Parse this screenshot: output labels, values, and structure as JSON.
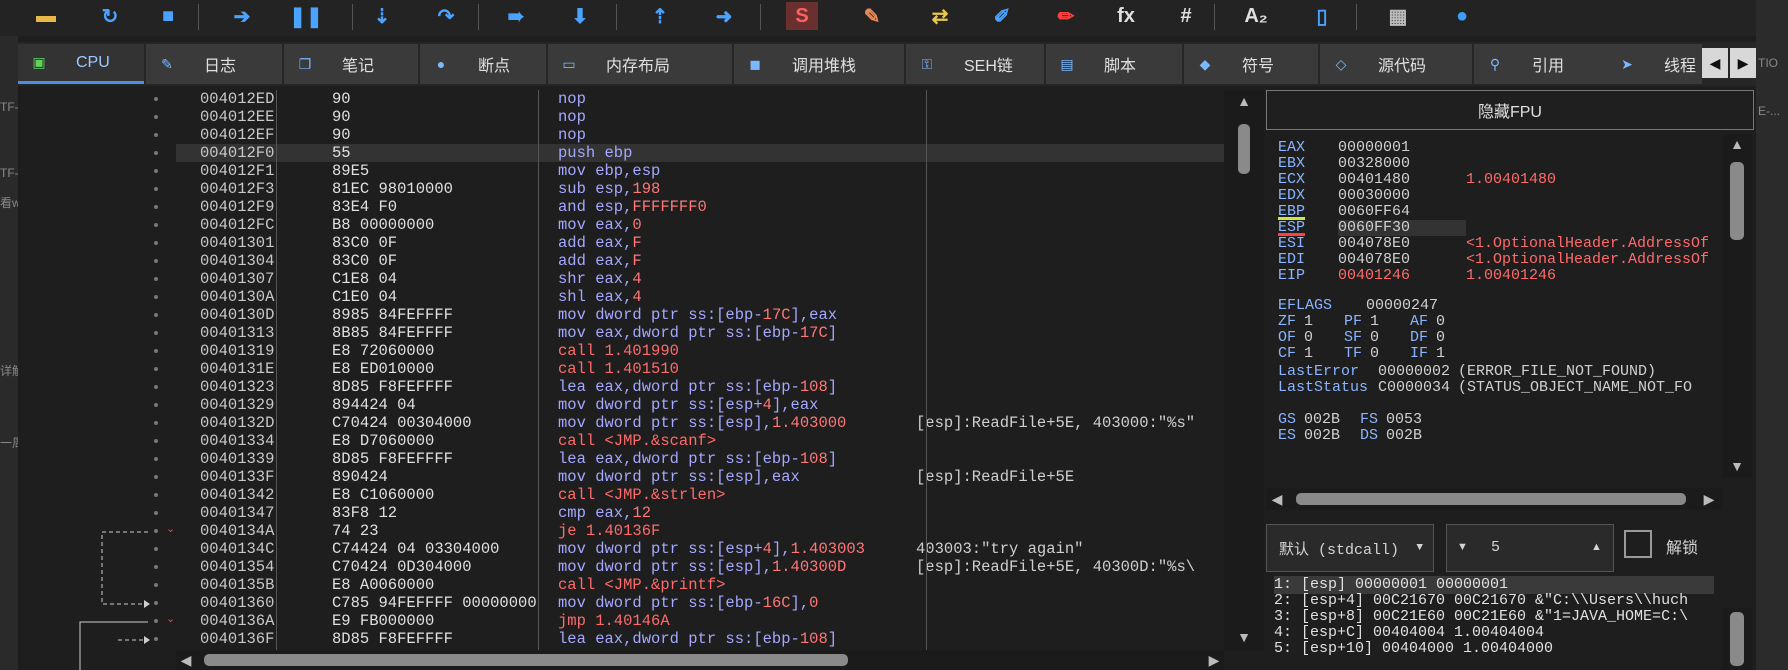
{
  "toolbar": {
    "buttons": [
      {
        "icon": "open-folder-icon",
        "glyph": "▬",
        "color": "#e8b84a"
      },
      {
        "icon": "restart-icon",
        "glyph": "↻",
        "color": "#4aa3ff"
      },
      {
        "icon": "close-icon",
        "glyph": "■",
        "color": "#4aa3ff"
      },
      {
        "icon": "run-icon",
        "glyph": "➔",
        "color": "#4aa3ff"
      },
      {
        "icon": "pause-icon",
        "glyph": "❚❚",
        "color": "#4aa3ff"
      },
      {
        "icon": "step-into-icon",
        "glyph": "⇣",
        "color": "#4aa3ff"
      },
      {
        "icon": "step-over-icon",
        "glyph": "↷",
        "color": "#4aa3ff"
      },
      {
        "icon": "trace-into-icon",
        "glyph": "➠",
        "color": "#4aa3ff"
      },
      {
        "icon": "trace-over-icon",
        "glyph": "⬇",
        "color": "#4aa3ff"
      },
      {
        "icon": "execute-till-return-icon",
        "glyph": "⇡",
        "color": "#4aa3ff"
      },
      {
        "icon": "run-to-user-code-icon",
        "glyph": "➜",
        "color": "#4aa3ff"
      },
      {
        "icon": "script-icon",
        "glyph": "S",
        "color": "#ff4040"
      },
      {
        "icon": "patch-icon",
        "glyph": "✎",
        "color": "#e88a5a"
      },
      {
        "icon": "memory-map-icon",
        "glyph": "⇄",
        "color": "#e8c84a"
      },
      {
        "icon": "breakpoints-icon",
        "glyph": "✐",
        "color": "#4aa3ff"
      },
      {
        "icon": "highlight-icon",
        "glyph": "✏",
        "color": "#ff4040"
      },
      {
        "icon": "function-icon",
        "glyph": "fx",
        "color": "#e0e0e0"
      },
      {
        "icon": "hash-icon",
        "glyph": "#",
        "color": "#e0e0e0"
      },
      {
        "icon": "font-icon",
        "glyph": "A₂",
        "color": "#e0e0e0"
      },
      {
        "icon": "device-icon",
        "glyph": "▯",
        "color": "#4aa3ff"
      },
      {
        "icon": "calculator-icon",
        "glyph": "▦",
        "color": "#bbbbbb"
      },
      {
        "icon": "globe-icon",
        "glyph": "●",
        "color": "#3aa0ff"
      }
    ]
  },
  "left_cut_text": [
    "TF-",
    "TF-",
    "看w",
    "详解",
    "一周"
  ],
  "right_cut_text": [
    "TIO",
    "E-..."
  ],
  "tabs": [
    {
      "label": "CPU",
      "icon": "cpu-icon",
      "glyph": "▣",
      "active": true
    },
    {
      "label": "日志",
      "icon": "log-icon",
      "glyph": "✎",
      "active": false
    },
    {
      "label": "笔记",
      "icon": "notes-icon",
      "glyph": "❐",
      "active": false
    },
    {
      "label": "断点",
      "icon": "breakpoint-icon",
      "glyph": "●",
      "active": false
    },
    {
      "label": "内存布局",
      "icon": "memory-layout-icon",
      "glyph": "▭",
      "active": false
    },
    {
      "label": "调用堆栈",
      "icon": "call-stack-icon",
      "glyph": "◼",
      "active": false
    },
    {
      "label": "SEH链",
      "icon": "seh-chain-icon",
      "glyph": "⚿",
      "active": false
    },
    {
      "label": "脚本",
      "icon": "script-tab-icon",
      "glyph": "▤",
      "active": false
    },
    {
      "label": "符号",
      "icon": "symbols-icon",
      "glyph": "◆",
      "active": false
    },
    {
      "label": "源代码",
      "icon": "source-code-icon",
      "glyph": "◇",
      "active": false
    },
    {
      "label": "引用",
      "icon": "references-icon",
      "glyph": "⚲",
      "active": false
    },
    {
      "label": "线程",
      "icon": "threads-icon",
      "glyph": "➤",
      "active": false
    }
  ],
  "tab_nav": {
    "prev": "◀",
    "next": "▶"
  },
  "disasm": {
    "rows": [
      {
        "addr": "004012ED",
        "bytes": "90",
        "instr": [
          {
            "t": "nop"
          }
        ],
        "comment": ""
      },
      {
        "addr": "004012EE",
        "bytes": "90",
        "instr": [
          {
            "t": "nop"
          }
        ],
        "comment": ""
      },
      {
        "addr": "004012EF",
        "bytes": "90",
        "instr": [
          {
            "t": "nop"
          }
        ],
        "comment": ""
      },
      {
        "addr": "004012F0",
        "bytes": "55",
        "instr": [
          {
            "t": "push ebp"
          }
        ],
        "comment": "",
        "selected": true
      },
      {
        "addr": "004012F1",
        "bytes": "89E5",
        "instr": [
          {
            "t": "mov ebp,esp"
          }
        ],
        "comment": ""
      },
      {
        "addr": "004012F3",
        "bytes": "81EC 98010000",
        "instr": [
          {
            "t": "sub esp,"
          },
          {
            "t": "198",
            "c": "num"
          }
        ],
        "comment": ""
      },
      {
        "addr": "004012F9",
        "bytes": "83E4 F0",
        "instr": [
          {
            "t": "and esp,"
          },
          {
            "t": "FFFFFFF0",
            "c": "num"
          }
        ],
        "comment": ""
      },
      {
        "addr": "004012FC",
        "bytes": "B8 00000000",
        "instr": [
          {
            "t": "mov eax,"
          },
          {
            "t": "0",
            "c": "num"
          }
        ],
        "comment": ""
      },
      {
        "addr": "00401301",
        "bytes": "83C0 0F",
        "instr": [
          {
            "t": "add eax,"
          },
          {
            "t": "F",
            "c": "num"
          }
        ],
        "comment": ""
      },
      {
        "addr": "00401304",
        "bytes": "83C0 0F",
        "instr": [
          {
            "t": "add eax,"
          },
          {
            "t": "F",
            "c": "num"
          }
        ],
        "comment": ""
      },
      {
        "addr": "00401307",
        "bytes": "C1E8 04",
        "instr": [
          {
            "t": "shr eax,"
          },
          {
            "t": "4",
            "c": "num"
          }
        ],
        "comment": ""
      },
      {
        "addr": "0040130A",
        "bytes": "C1E0 04",
        "instr": [
          {
            "t": "shl eax,"
          },
          {
            "t": "4",
            "c": "num"
          }
        ],
        "comment": ""
      },
      {
        "addr": "0040130D",
        "bytes": "8985 84FEFFFF",
        "instr": [
          {
            "t": "mov dword ptr ss:[ebp-"
          },
          {
            "t": "17C",
            "c": "num"
          },
          {
            "t": "],eax"
          }
        ],
        "comment": ""
      },
      {
        "addr": "00401313",
        "bytes": "8B85 84FEFFFF",
        "instr": [
          {
            "t": "mov eax,dword ptr ss:[ebp-"
          },
          {
            "t": "17C",
            "c": "num"
          },
          {
            "t": "]"
          }
        ],
        "comment": ""
      },
      {
        "addr": "00401319",
        "bytes": "E8 72060000",
        "instr": [
          {
            "t": "call 1.401990",
            "c": "call"
          }
        ],
        "comment": ""
      },
      {
        "addr": "0040131E",
        "bytes": "E8 ED010000",
        "instr": [
          {
            "t": "call 1.401510",
            "c": "call"
          }
        ],
        "comment": ""
      },
      {
        "addr": "00401323",
        "bytes": "8D85 F8FEFFFF",
        "instr": [
          {
            "t": "lea eax,dword ptr ss:[ebp-"
          },
          {
            "t": "108",
            "c": "num"
          },
          {
            "t": "]"
          }
        ],
        "comment": ""
      },
      {
        "addr": "00401329",
        "bytes": "894424 04",
        "instr": [
          {
            "t": "mov dword ptr ss:[esp+"
          },
          {
            "t": "4",
            "c": "num"
          },
          {
            "t": "],eax"
          }
        ],
        "comment": ""
      },
      {
        "addr": "0040132D",
        "bytes": "C70424 00304000",
        "instr": [
          {
            "t": "mov dword ptr ss:[esp],"
          },
          {
            "t": "1.403000",
            "c": "num"
          }
        ],
        "comment": "[esp]:ReadFile+5E, 403000:\"%s\""
      },
      {
        "addr": "00401334",
        "bytes": "E8 D7060000",
        "instr": [
          {
            "t": "call <JMP.&scanf>",
            "c": "call"
          }
        ],
        "comment": ""
      },
      {
        "addr": "00401339",
        "bytes": "8D85 F8FEFFFF",
        "instr": [
          {
            "t": "lea eax,dword ptr ss:[ebp-"
          },
          {
            "t": "108",
            "c": "num"
          },
          {
            "t": "]"
          }
        ],
        "comment": ""
      },
      {
        "addr": "0040133F",
        "bytes": "890424",
        "instr": [
          {
            "t": "mov dword ptr ss:[esp],eax"
          }
        ],
        "comment": "[esp]:ReadFile+5E"
      },
      {
        "addr": "00401342",
        "bytes": "E8 C1060000",
        "instr": [
          {
            "t": "call <JMP.&strlen>",
            "c": "call"
          }
        ],
        "comment": ""
      },
      {
        "addr": "00401347",
        "bytes": "83F8 12",
        "instr": [
          {
            "t": "cmp eax,"
          },
          {
            "t": "12",
            "c": "num"
          }
        ],
        "comment": ""
      },
      {
        "addr": "0040134A",
        "bytes": "74 23",
        "instr": [
          {
            "t": "je 1.40136F",
            "c": "jmp"
          }
        ],
        "comment": "",
        "branch": true
      },
      {
        "addr": "0040134C",
        "bytes": "C74424 04 03304000",
        "instr": [
          {
            "t": "mov dword ptr ss:[esp+"
          },
          {
            "t": "4",
            "c": "num"
          },
          {
            "t": "],"
          },
          {
            "t": "1.403003",
            "c": "num"
          }
        ],
        "comment": "403003:\"try again\""
      },
      {
        "addr": "00401354",
        "bytes": "C70424 0D304000",
        "instr": [
          {
            "t": "mov dword ptr ss:[esp],"
          },
          {
            "t": "1.40300D",
            "c": "num"
          }
        ],
        "comment": "[esp]:ReadFile+5E, 40300D:\"%s\\"
      },
      {
        "addr": "0040135B",
        "bytes": "E8 A0060000",
        "instr": [
          {
            "t": "call <JMP.&printf>",
            "c": "call"
          }
        ],
        "comment": ""
      },
      {
        "addr": "00401360",
        "bytes": "C785 94FEFFFF 00000000",
        "instr": [
          {
            "t": "mov dword ptr ss:[ebp-"
          },
          {
            "t": "16C",
            "c": "num"
          },
          {
            "t": "],"
          },
          {
            "t": "0",
            "c": "num"
          }
        ],
        "comment": ""
      },
      {
        "addr": "0040136A",
        "bytes": "E9 FB000000",
        "instr": [
          {
            "t": "jmp 1.40146A",
            "c": "jmp"
          }
        ],
        "comment": "",
        "branch": true
      },
      {
        "addr": "0040136F",
        "bytes": "8D85 F8FEFFFF",
        "instr": [
          {
            "t": "lea eax,dword ptr ss:[ebp-"
          },
          {
            "t": "108",
            "c": "num"
          },
          {
            "t": "]"
          }
        ],
        "comment": ""
      }
    ]
  },
  "fpu_button": "隐藏FPU",
  "registers": {
    "gp": [
      {
        "name": "EAX",
        "value": "00000001",
        "comment": ""
      },
      {
        "name": "EBX",
        "value": "00328000",
        "comment": ""
      },
      {
        "name": "ECX",
        "value": "00401480",
        "comment": "1.00401480"
      },
      {
        "name": "EDX",
        "value": "00030000",
        "comment": ""
      },
      {
        "name": "EBP",
        "value": "0060FF64",
        "comment": "",
        "marker": "#c8e84a"
      },
      {
        "name": "ESP",
        "value": "0060FF30",
        "comment": "",
        "marker": "#ff4040"
      },
      {
        "name": "ESI",
        "value": "004078E0",
        "comment": "<1.OptionalHeader.AddressOf"
      },
      {
        "name": "EDI",
        "value": "004078E0",
        "comment": "<1.OptionalHeader.AddressOf"
      }
    ],
    "eip": {
      "name": "EIP",
      "value": "00401246",
      "comment": "1.00401246"
    },
    "eflags": {
      "name": "EFLAGS",
      "value": "00000247"
    },
    "flags": [
      [
        {
          "n": "ZF",
          "v": "1"
        },
        {
          "n": "PF",
          "v": "1"
        },
        {
          "n": "AF",
          "v": "0"
        }
      ],
      [
        {
          "n": "OF",
          "v": "0"
        },
        {
          "n": "SF",
          "v": "0"
        },
        {
          "n": "DF",
          "v": "0"
        }
      ],
      [
        {
          "n": "CF",
          "v": "1"
        },
        {
          "n": "TF",
          "v": "0"
        },
        {
          "n": "IF",
          "v": "1"
        }
      ]
    ],
    "lasterror": {
      "name": "LastError",
      "value": "00000002",
      "comment": "(ERROR_FILE_NOT_FOUND)"
    },
    "laststatus": {
      "name": "LastStatus",
      "value": "C0000034",
      "comment": "(STATUS_OBJECT_NAME_NOT_FO"
    },
    "segs": [
      [
        {
          "n": "GS",
          "v": "002B"
        },
        {
          "n": "FS",
          "v": "0053"
        }
      ],
      [
        {
          "n": "ES",
          "v": "002B"
        },
        {
          "n": "DS",
          "v": "002B"
        }
      ]
    ]
  },
  "call_convention": {
    "value": "默认 (stdcall)"
  },
  "arg_count": {
    "value": "5"
  },
  "unlock_label": "解锁",
  "stack_args": [
    "1: [esp] 00000001 00000001",
    "2: [esp+4] 00C21670 00C21670 &\"C:\\\\Users\\\\huch",
    "3: [esp+8] 00C21E60 00C21E60 &\"1=JAVA_HOME=C:\\",
    "4: [esp+C] 00404004 1.00404004",
    "5: [esp+10] 00404000 1.00404000"
  ]
}
